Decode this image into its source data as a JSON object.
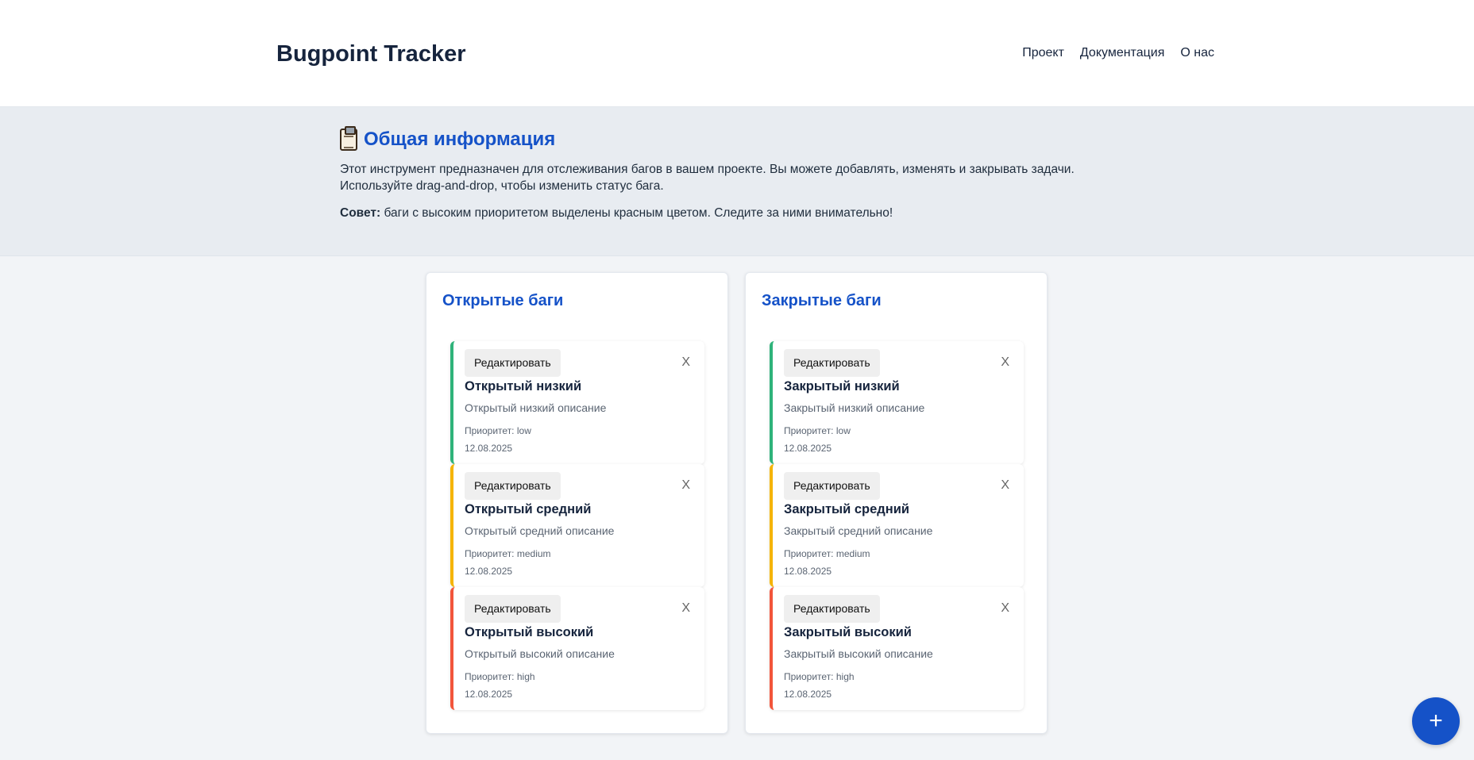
{
  "app": {
    "title": "Bugpoint Tracker"
  },
  "nav": [
    "Проект",
    "Документация",
    "О нас"
  ],
  "info": {
    "title": "Общая информация",
    "text_line1": "Этот инструмент предназначен для отслеживания багов в вашем проекте. Вы можете добавлять, изменять и закрывать задачи.",
    "text_line2": "Используйте drag-and-drop, чтобы изменить статус бага.",
    "tip_label": "Совет:",
    "tip_text": " баги с высоким приоритетом выделены красным цветом. Следите за ними внимательно!"
  },
  "columns": [
    {
      "title": "Открытые баги",
      "cards": [
        {
          "edit": "Редактировать",
          "close": "X",
          "title": "Открытый низкий",
          "desc": "Открытый низкий описание",
          "priority": "Приоритет: low",
          "date": "12.08.2025"
        },
        {
          "edit": "Редактировать",
          "close": "X",
          "title": "Открытый средний",
          "desc": "Открытый средний описание",
          "priority": "Приоритет: medium",
          "date": "12.08.2025"
        },
        {
          "edit": "Редактировать",
          "close": "X",
          "title": "Открытый высокий",
          "desc": "Открытый высокий описание",
          "priority": "Приоритет: high",
          "date": "12.08.2025"
        }
      ]
    },
    {
      "title": "Закрытые баги",
      "cards": [
        {
          "edit": "Редактировать",
          "close": "X",
          "title": "Закрытый низкий",
          "desc": "Закрытый низкий описание",
          "priority": "Приоритет: low",
          "date": "12.08.2025"
        },
        {
          "edit": "Редактировать",
          "close": "X",
          "title": "Закрытый средний",
          "desc": "Закрытый средний описание",
          "priority": "Приоритет: medium",
          "date": "12.08.2025"
        },
        {
          "edit": "Редактировать",
          "close": "X",
          "title": "Закрытый высокий",
          "desc": "Закрытый высокий описание",
          "priority": "Приоритет: high",
          "date": "12.08.2025"
        }
      ]
    }
  ],
  "fab": {
    "label": "+"
  },
  "colors": {
    "accent": "#1552c8",
    "low": "#2fb37a",
    "medium": "#f5b400",
    "high": "#f2553b"
  },
  "icons": {
    "info_icon": "clipboard-icon"
  }
}
